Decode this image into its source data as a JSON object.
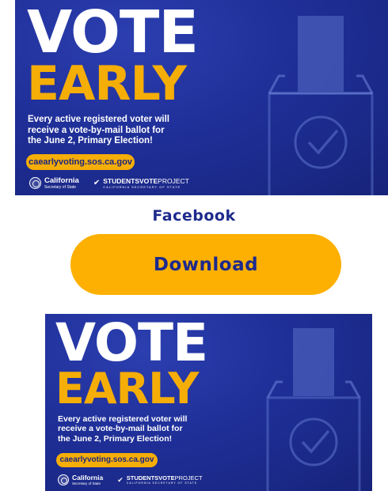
{
  "posters": [
    {
      "headline_line1": "VOTE",
      "headline_line2": "EARLY",
      "tagline_line1": "Every active registered voter will",
      "tagline_line2": "receive a vote-by-mail ballot for",
      "tagline_line3": "the June 2, Primary Election!",
      "url": "caearlyvoting.sos.ca.gov",
      "ca_name": "California",
      "ca_sub": "Secretary of State",
      "svp_pre": "STUDENTS",
      "svp_bold": "VOTE",
      "svp_post": "PROJECT",
      "svp_sub": "CALIFORNIA SECRETARY OF STATE"
    },
    {
      "headline_line1": "VOTE",
      "headline_line2": "EARLY",
      "tagline_line1": "Every active registered voter will",
      "tagline_line2": "receive a vote-by-mail ballot for",
      "tagline_line3": "the June 2, Primary Election!",
      "url": "caearlyvoting.sos.ca.gov",
      "ca_name": "California",
      "ca_sub": "Secretary of State",
      "svp_pre": "STUDENTS",
      "svp_bold": "VOTE",
      "svp_post": "PROJECT",
      "svp_sub": "CALIFORNIA SECRETARY OF STATE"
    }
  ],
  "platform_label": "Facebook",
  "download_label": "Download",
  "colors": {
    "banner_blue": "#1f2f98",
    "accent_yellow": "#f5ad08",
    "button_yellow": "#fdb002",
    "label_navy": "#1d2a8c"
  }
}
